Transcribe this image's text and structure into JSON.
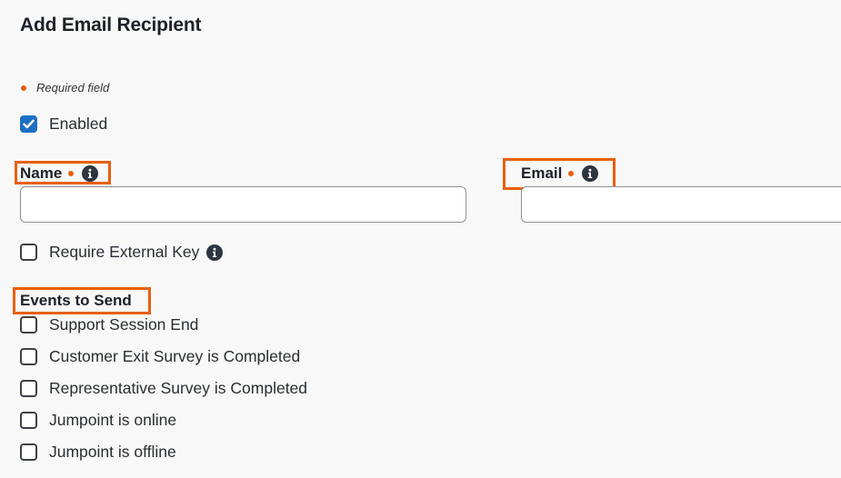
{
  "form": {
    "title": "Add Email Recipient",
    "required_note": "Required field",
    "enabled": {
      "label": "Enabled",
      "checked": true
    },
    "name_field": {
      "label": "Name",
      "value": "",
      "placeholder": ""
    },
    "email_field": {
      "label": "Email",
      "value": "",
      "placeholder": ""
    },
    "require_external_key": {
      "label": "Require External Key",
      "checked": false
    },
    "events_heading": "Events to Send",
    "events": [
      {
        "label": "Support Session End",
        "checked": false
      },
      {
        "label": "Customer Exit Survey is Completed",
        "checked": false
      },
      {
        "label": "Representative Survey is Completed",
        "checked": false
      },
      {
        "label": "Jumpoint is online",
        "checked": false
      },
      {
        "label": "Jumpoint is offline",
        "checked": false
      }
    ]
  },
  "colors": {
    "accent": "#1e6fc4",
    "required_dot": "#e8600c",
    "highlight_box": "#e8600c",
    "info_icon": "#2d3540"
  },
  "icons": {
    "info": "info-circle-icon",
    "check": "checkmark-icon"
  }
}
